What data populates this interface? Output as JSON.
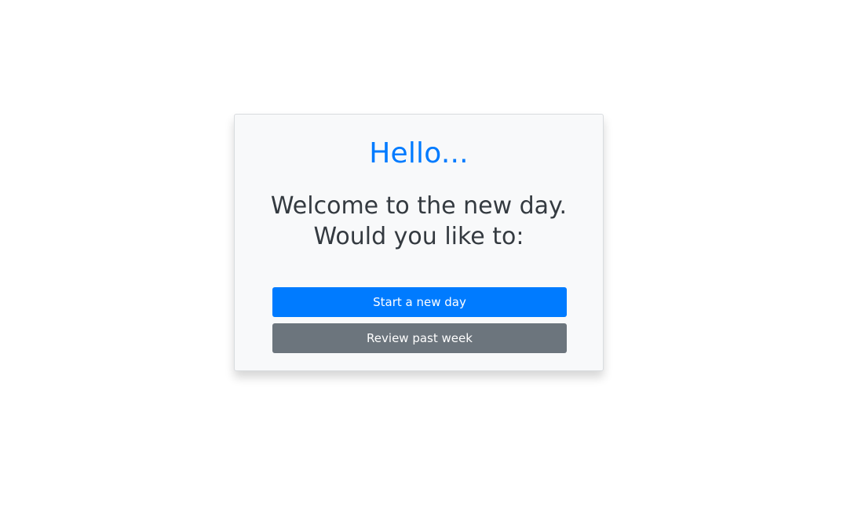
{
  "card": {
    "greeting": "Hello...",
    "message_line1": "Welcome to the new day.",
    "message_line2": "Would you like to:"
  },
  "actions": {
    "start_label": "Start a new day",
    "review_label": "Review past week"
  },
  "colors": {
    "primary": "#007bff",
    "secondary": "#6c757d",
    "card_background": "#f8f9fa",
    "text_dark": "#343a40"
  }
}
